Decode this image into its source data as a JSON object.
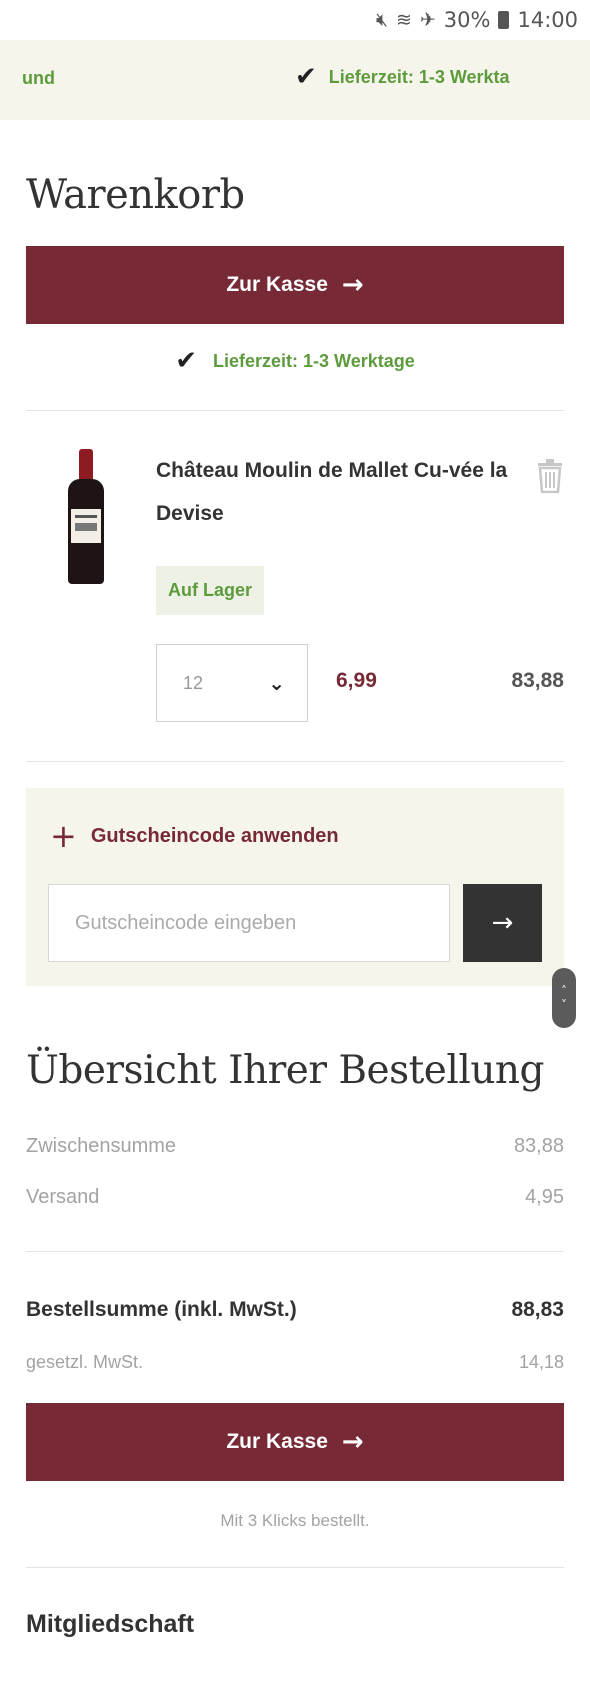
{
  "status_bar": {
    "icons": [
      "mute-icon",
      "wifi-icon",
      "airplane-icon"
    ],
    "battery": "30%",
    "time": "14:00"
  },
  "banner": {
    "left_text": "und",
    "delivery_text": "Lieferzeit: 1-3 Werkta"
  },
  "cart": {
    "title": "Warenkorb",
    "checkout_label": "Zur Kasse",
    "delivery_note": "Lieferzeit: 1-3 Werktage",
    "item": {
      "name": "Château Moulin de Mallet Cu-vée la Devise",
      "stock": "Auf Lager",
      "quantity": "12",
      "unit_price": "6,99",
      "total": "83,88"
    }
  },
  "coupon": {
    "toggle_label": "Gutscheincode anwenden",
    "placeholder": "Gutscheincode eingeben"
  },
  "summary": {
    "title": "Übersicht Ihrer Bestellung",
    "subtotal_label": "Zwischensumme",
    "subtotal_value": "83,88",
    "shipping_label": "Versand",
    "shipping_value": "4,95",
    "order_total_label": "Bestellsumme (inkl. MwSt.)",
    "order_total_value": "88,83",
    "vat_label": "gesetzl. MwSt.",
    "vat_value": "14,18",
    "checkout_label": "Zur Kasse",
    "note": "Mit 3 Klicks bestellt."
  },
  "membership": {
    "title": "Mitgliedschaft"
  },
  "colors": {
    "brand": "#772a36",
    "success": "#5d9b3c",
    "banner_bg": "#f6f5ec"
  }
}
